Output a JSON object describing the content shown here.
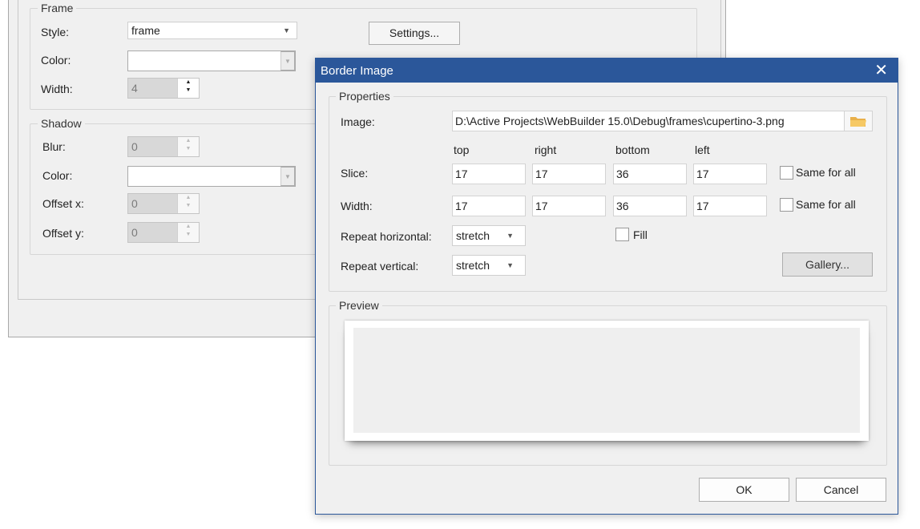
{
  "background_dialog": {
    "frame_group": {
      "title": "Frame",
      "style_label": "Style:",
      "style_value": "frame",
      "color_label": "Color:",
      "width_label": "Width:",
      "width_value": "4",
      "settings_button": "Settings..."
    },
    "shadow_group": {
      "title": "Shadow",
      "blur_label": "Blur:",
      "blur_value": "0",
      "color_label": "Color:",
      "offset_x_label": "Offset x:",
      "offset_x_value": "0",
      "offset_y_label": "Offset y:",
      "offset_y_value": "0"
    }
  },
  "dialog": {
    "title": "Border Image",
    "close_glyph": "✕",
    "properties": {
      "title": "Properties",
      "image_label": "Image:",
      "image_path": "D:\\Active Projects\\WebBuilder 15.0\\Debug\\frames\\cupertino-3.png",
      "columns": [
        "top",
        "right",
        "bottom",
        "left"
      ],
      "slice_label": "Slice:",
      "slice_values": [
        "17",
        "17",
        "36",
        "17"
      ],
      "width_label": "Width:",
      "width_values": [
        "17",
        "17",
        "36",
        "17"
      ],
      "same_for_all": "Same for all",
      "repeat_horizontal_label": "Repeat horizontal:",
      "repeat_horizontal_value": "stretch",
      "repeat_vertical_label": "Repeat vertical:",
      "repeat_vertical_value": "stretch",
      "fill_label": "Fill",
      "gallery_button": "Gallery..."
    },
    "preview": {
      "title": "Preview"
    },
    "ok_button": "OK",
    "cancel_button": "Cancel"
  },
  "colors": {
    "titlebar": "#2b579a",
    "dialog_bg": "#f0f0f0",
    "folder_icon": "#f3c257"
  }
}
